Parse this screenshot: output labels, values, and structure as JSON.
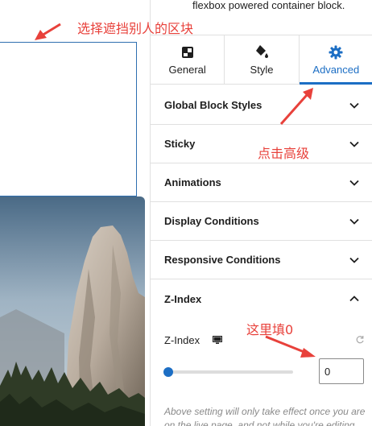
{
  "sidebar": {
    "top_description": "flexbox powered container block.",
    "tabs": [
      {
        "label": "General",
        "icon": "layout-icon"
      },
      {
        "label": "Style",
        "icon": "paint-bucket-icon"
      },
      {
        "label": "Advanced",
        "icon": "gear-icon",
        "active": true
      }
    ],
    "panels": [
      {
        "label": "Global Block Styles",
        "expanded": false
      },
      {
        "label": "Sticky",
        "expanded": false
      },
      {
        "label": "Animations",
        "expanded": false
      },
      {
        "label": "Display Conditions",
        "expanded": false
      },
      {
        "label": "Responsive Conditions",
        "expanded": false
      },
      {
        "label": "Z-Index",
        "expanded": true
      }
    ],
    "zindex": {
      "field_label": "Z-Index",
      "value": "0",
      "slider_fraction": 0.0,
      "note": "Above setting will only take effect once you are on the live page, and not while you're editing."
    }
  },
  "annotations": {
    "select_block": "选择遮挡别人的区块",
    "click_advanced": "点击高级",
    "fill_zero": "这里填0"
  },
  "colors": {
    "accent": "#1c6ec4",
    "annotation": "#e8413b",
    "border": "#e0e0e0"
  }
}
